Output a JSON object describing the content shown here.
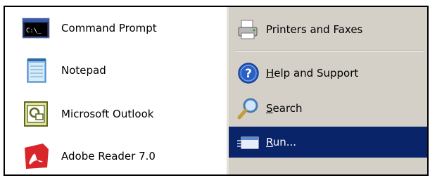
{
  "start_menu": {
    "programs": [
      {
        "label": "Command Prompt",
        "icon": "command-prompt-icon"
      },
      {
        "label": "Notepad",
        "icon": "notepad-icon"
      },
      {
        "label": "Microsoft Outlook",
        "icon": "outlook-icon"
      },
      {
        "label": "Adobe Reader 7.0",
        "icon": "adobe-reader-icon"
      }
    ],
    "places": [
      {
        "label": "Printers and Faxes",
        "icon": "printer-icon"
      },
      {
        "label_pre": "",
        "label_access": "H",
        "label_post": "elp and Support",
        "icon": "help-icon"
      },
      {
        "label_pre": "",
        "label_access": "S",
        "label_post": "earch",
        "icon": "search-icon"
      },
      {
        "label_pre": "",
        "label_access": "R",
        "label_post": "un...",
        "icon": "run-icon",
        "highlighted": true
      }
    ]
  },
  "colors": {
    "left_pane_bg": "#ffffff",
    "right_pane_bg": "#d4d0c8",
    "highlight_bg": "#0a246a",
    "highlight_text": "#ffffff"
  }
}
